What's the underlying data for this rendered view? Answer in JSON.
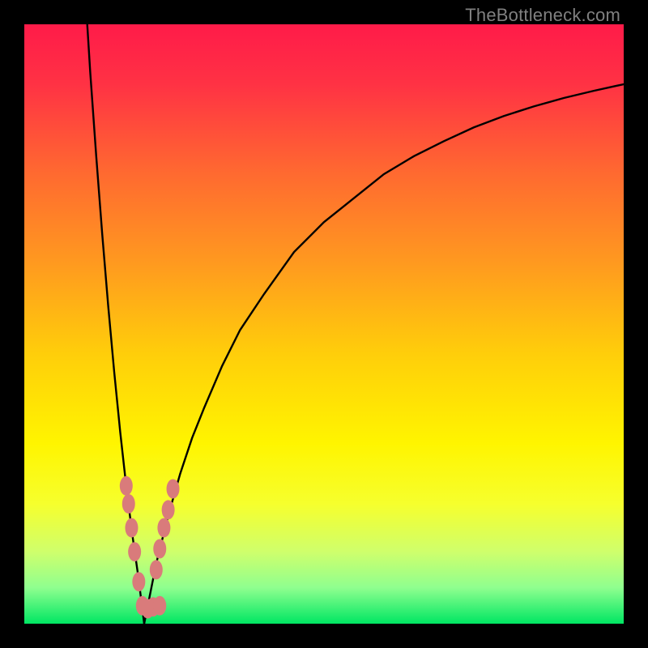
{
  "watermark": "TheBottleneck.com",
  "colors": {
    "frame": "#000000",
    "curve": "#000000",
    "dot_fill": "#d97b7b",
    "dot_stroke": "#c96a6a",
    "gradient_stops": [
      {
        "offset": 0.0,
        "color": "#ff1b49"
      },
      {
        "offset": 0.1,
        "color": "#ff3244"
      },
      {
        "offset": 0.25,
        "color": "#ff6a30"
      },
      {
        "offset": 0.4,
        "color": "#ff9a1f"
      },
      {
        "offset": 0.55,
        "color": "#ffce0a"
      },
      {
        "offset": 0.7,
        "color": "#fff500"
      },
      {
        "offset": 0.8,
        "color": "#f6ff2d"
      },
      {
        "offset": 0.88,
        "color": "#cfff6c"
      },
      {
        "offset": 0.94,
        "color": "#8fff8f"
      },
      {
        "offset": 1.0,
        "color": "#00e663"
      }
    ]
  },
  "chart_data": {
    "type": "line",
    "title": "",
    "xlabel": "",
    "ylabel": "",
    "xlim": [
      0,
      100
    ],
    "ylim": [
      0,
      100
    ],
    "vertex_x": 20,
    "series": [
      {
        "name": "left-branch",
        "x": [
          10.5,
          11,
          12,
          13,
          14,
          15,
          16,
          17,
          18,
          19,
          19.5,
          20
        ],
        "values": [
          100,
          92,
          78,
          65,
          53,
          42,
          32,
          23,
          15,
          8,
          4,
          0
        ]
      },
      {
        "name": "right-branch",
        "x": [
          20,
          21,
          22,
          23,
          24,
          26,
          28,
          30,
          33,
          36,
          40,
          45,
          50,
          55,
          60,
          65,
          70,
          75,
          80,
          85,
          90,
          95,
          100
        ],
        "values": [
          0,
          5,
          10,
          14,
          18,
          25,
          31,
          36,
          43,
          49,
          55,
          62,
          67,
          71,
          75,
          78,
          80.5,
          82.8,
          84.7,
          86.3,
          87.7,
          88.9,
          90
        ]
      }
    ],
    "annotations": {
      "dots": [
        {
          "x": 17.0,
          "y": 23.0
        },
        {
          "x": 17.4,
          "y": 20.0
        },
        {
          "x": 17.9,
          "y": 16.0
        },
        {
          "x": 18.4,
          "y": 12.0
        },
        {
          "x": 19.1,
          "y": 7.0
        },
        {
          "x": 19.7,
          "y": 3.0
        },
        {
          "x": 20.6,
          "y": 2.5
        },
        {
          "x": 21.5,
          "y": 2.8
        },
        {
          "x": 22.6,
          "y": 3.0
        },
        {
          "x": 22.0,
          "y": 9.0
        },
        {
          "x": 22.6,
          "y": 12.5
        },
        {
          "x": 23.3,
          "y": 16.0
        },
        {
          "x": 24.0,
          "y": 19.0
        },
        {
          "x": 24.8,
          "y": 22.5
        }
      ]
    }
  }
}
